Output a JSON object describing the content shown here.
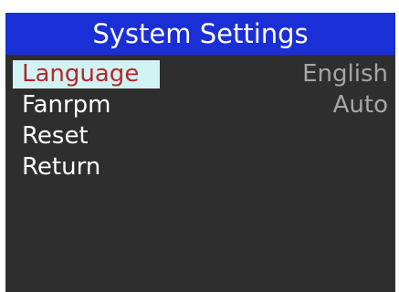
{
  "header": {
    "title": "System Settings"
  },
  "menu": {
    "items": [
      {
        "label": "Language",
        "value": "English",
        "selected": true
      },
      {
        "label": "Fanrpm",
        "value": "Auto",
        "selected": false
      },
      {
        "label": "Reset"
      },
      {
        "label": "Return"
      }
    ]
  },
  "colors": {
    "title_bar": "#1a2fd6",
    "screen_background": "#2e2e2e",
    "highlight_background": "#d2f3f3",
    "selected_text": "#b3282a",
    "item_text": "#ffffff",
    "value_text": "#a6a6a6"
  }
}
